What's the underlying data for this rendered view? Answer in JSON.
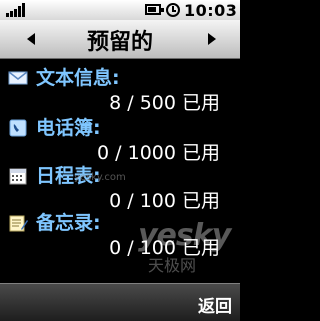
{
  "status_bar": {
    "time": "10:03",
    "signal_bars": 5,
    "battery_level": 0.8
  },
  "header": {
    "title": "预留的"
  },
  "sections": [
    {
      "icon": "envelope-icon",
      "label": "文本信息:",
      "usage": "8 / 500 已用"
    },
    {
      "icon": "phonebook-icon",
      "label": "电话簿:",
      "usage": "0 / 1000 已用"
    },
    {
      "icon": "calendar-icon",
      "label": "日程表:",
      "usage": "0 / 100 已用"
    },
    {
      "icon": "memo-icon",
      "label": "备忘录:",
      "usage": "0 / 100 已用"
    }
  ],
  "softkeys": {
    "back_label": "返回"
  },
  "watermark": {
    "url": "yesky.com",
    "brand": "yesky",
    "brand_cn": "天极网"
  }
}
